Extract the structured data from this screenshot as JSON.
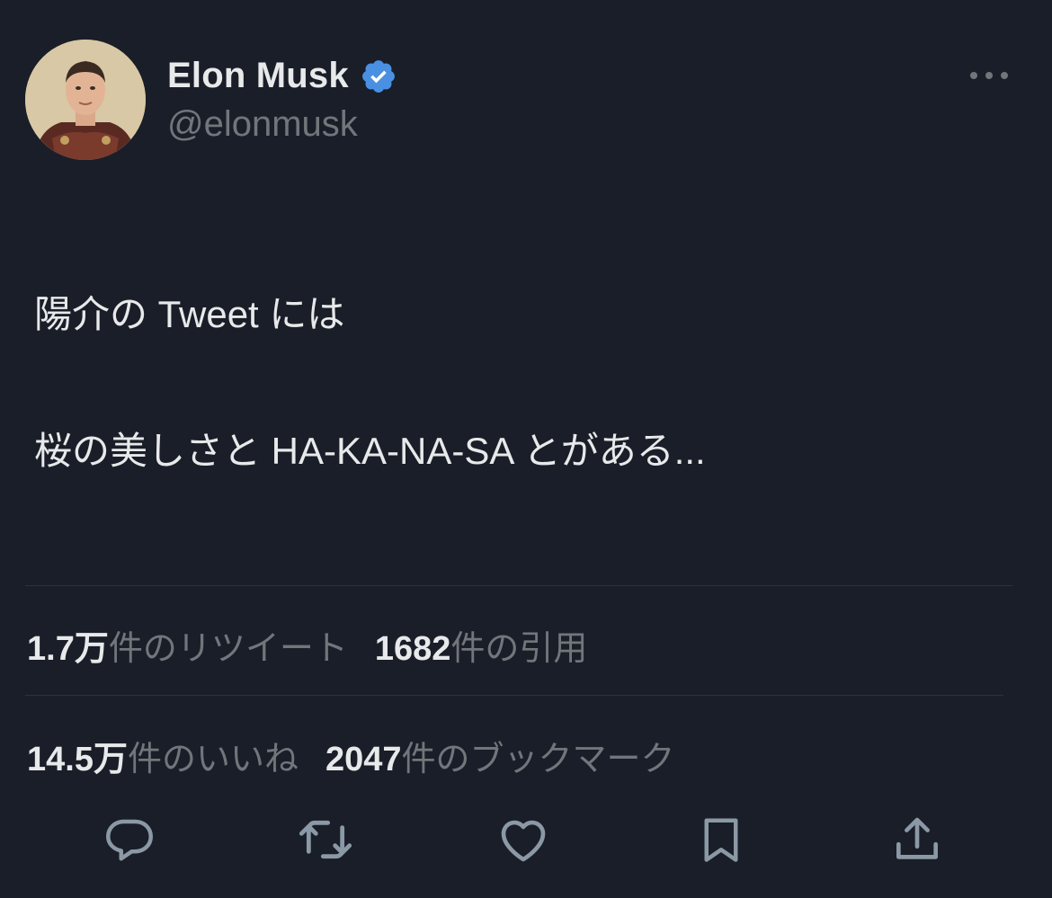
{
  "author": {
    "display_name": "Elon Musk",
    "handle": "@elonmusk",
    "verified": true,
    "avatar_icon": "profile-photo",
    "verified_icon": "verified-badge-icon",
    "verified_color": "#4a90e2"
  },
  "tweet": {
    "line1": "陽介の Tweet には",
    "line2": "桜の美しさと HA-KA-NA-SA とがある..."
  },
  "stats": {
    "retweets_count": "1.7万",
    "retweets_label": "件のリツイート",
    "quotes_count": "1682",
    "quotes_label": " 件の引用",
    "likes_count": "14.5万",
    "likes_label": "件のいいね",
    "bookmarks_count": "2047",
    "bookmarks_label": " 件のブックマーク"
  },
  "actions": {
    "reply_icon": "reply-icon",
    "retweet_icon": "retweet-icon",
    "like_icon": "heart-icon",
    "bookmark_icon": "bookmark-icon",
    "share_icon": "share-icon",
    "more_icon": "more-dots-icon"
  },
  "colors": {
    "background": "#1a1e28",
    "primary_text": "#e7e9ea",
    "secondary_text": "#71767b",
    "divider": "#2f3336",
    "icon": "#8b98a5"
  }
}
